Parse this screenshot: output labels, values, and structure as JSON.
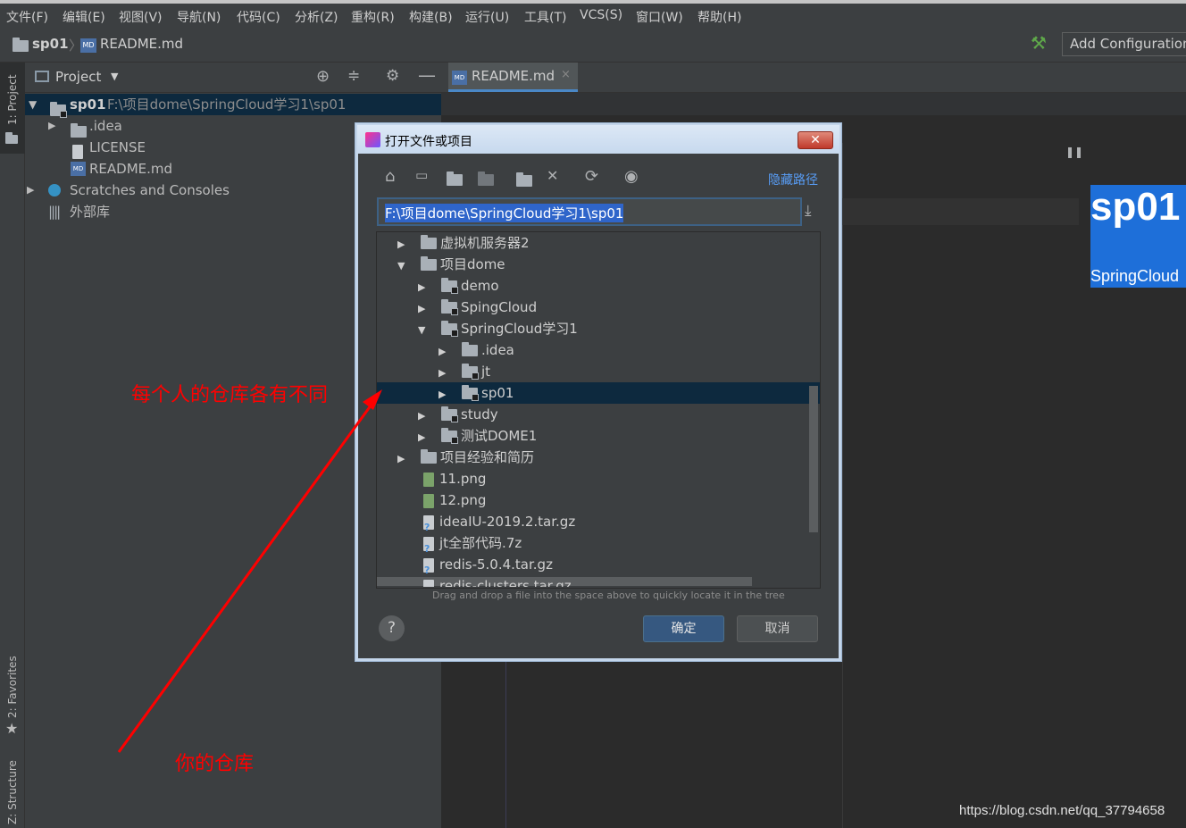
{
  "menu": [
    "文件(F)",
    "编辑(E)",
    "视图(V)",
    "导航(N)",
    "代码(C)",
    "分析(Z)",
    "重构(R)",
    "构建(B)",
    "运行(U)",
    "工具(T)",
    "VCS(S)",
    "窗口(W)",
    "帮助(H)"
  ],
  "navbar": {
    "project": "sp01",
    "file": "README.md",
    "add_config": "Add Configuration"
  },
  "side_tabs": {
    "project": "1: Project",
    "favorites": "2: Favorites",
    "structure": "Z: Structure"
  },
  "project_panel": {
    "title": "Project",
    "root_name": "sp01",
    "root_path": "F:\\项目dome\\SpringCloud学习1\\sp01",
    "items": [
      ".idea",
      "LICENSE",
      "README.md",
      "Scratches and Consoles",
      "外部库"
    ]
  },
  "editor": {
    "tab": "README.md",
    "preview_title": "sp01",
    "preview_subtitle": "SpringCloud"
  },
  "dialog": {
    "title": "打开文件或项目",
    "hide_path": "隐藏路径",
    "path_value": "F:\\项目dome\\SpringCloud学习1\\sp01",
    "tree": [
      "虚拟机服务器2",
      "项目dome",
      "demo",
      "SpingCloud",
      "SpringCloud学习1",
      ".idea",
      "jt",
      "sp01",
      "study",
      "测试DOME1",
      "项目经验和简历",
      "11.png",
      "12.png",
      "ideaIU-2019.2.tar.gz",
      "jt全部代码.7z",
      "redis-5.0.4.tar.gz",
      "redis-clusters.tar.gz"
    ],
    "hint": "Drag and drop a file into the space above to quickly locate it in the tree",
    "help": "?",
    "ok": "确定",
    "cancel": "取消"
  },
  "annotations": {
    "top": "每个人的仓库各有不同",
    "bottom": "你的仓库"
  },
  "watermark": "https://blog.csdn.net/qq_37794658",
  "colors": {
    "accent": "#2675bf",
    "selection": "#0d293e",
    "annotation_red": "#ff0000",
    "preview_blue": "#1e6fd9"
  }
}
